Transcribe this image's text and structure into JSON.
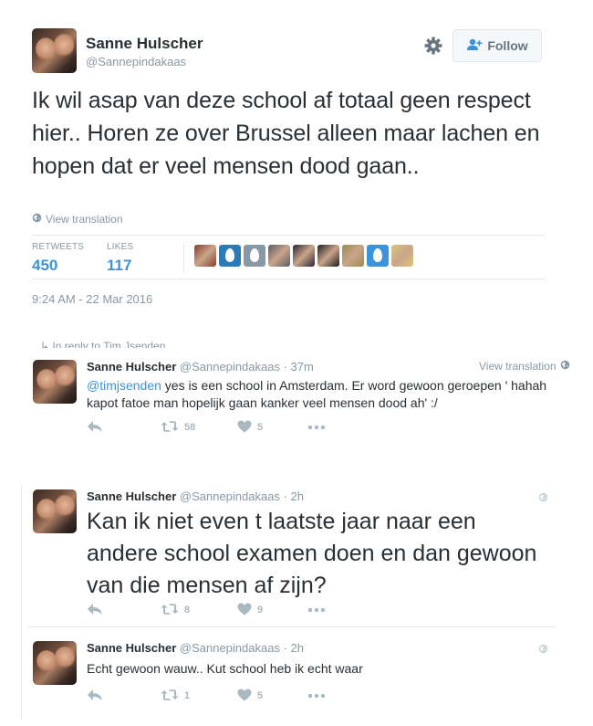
{
  "main_tweet": {
    "author_name": "Sanne Hulscher",
    "author_handle": "@Sannepindakaas",
    "follow_label": "Follow",
    "text": "Ik wil asap van deze school af totaal geen respect hier.. Horen ze over Brussel alleen maar lachen en hopen dat er veel mensen dood gaan..",
    "view_translation": "View translation",
    "retweets_label": "RETWEETS",
    "retweets_count": "450",
    "likes_label": "LIKES",
    "likes_count": "117",
    "timestamp": "9:24 AM - 22 Mar 2016",
    "liker_avatars": [
      {
        "icon": "photo-avatar",
        "color": "#8a3b2e"
      },
      {
        "icon": "egg-avatar",
        "color": "#2b7bb9"
      },
      {
        "icon": "egg-avatar",
        "color": "#8899a6"
      },
      {
        "icon": "photo-avatar",
        "color": "#5c5a66"
      },
      {
        "icon": "photo-avatar",
        "color": "#2a2230"
      },
      {
        "icon": "photo-avatar",
        "color": "#1d1d1d"
      },
      {
        "icon": "photo-avatar",
        "color": "#9a8a52"
      },
      {
        "icon": "egg-avatar",
        "color": "#3b94d9"
      },
      {
        "icon": "photo-avatar",
        "color": "#d8c77a"
      }
    ]
  },
  "cut_off_line": "↳ In reply to Tim Jsenden",
  "replies": [
    {
      "author_name": "Sanne Hulscher",
      "author_handle": "@Sannepindakaas · 37m",
      "view_translation": "View translation",
      "mention": "@timjsenden",
      "text": " yes is een school in Amsterdam. Er word gewoon geroepen ' hahah kapot fatoe man hopelijk gaan kanker veel mensen dood ah' :/",
      "retweets": "58",
      "likes": "5"
    },
    {
      "author_name": "Sanne Hulscher",
      "author_handle": "@Sannepindakaas · 2h",
      "text": "Kan ik niet even t laatste jaar naar een andere school examen doen en dan gewoon van die mensen af zijn?",
      "retweets": "8",
      "likes": "9"
    },
    {
      "author_name": "Sanne Hulscher",
      "author_handle": "@Sannepindakaas · 2h",
      "text": "Echt gewoon wauw.. Kut school heb ik echt waar",
      "retweets": "1",
      "likes": "5"
    }
  ],
  "colors": {
    "text": "#292f33",
    "muted": "#8899a6",
    "link": "#3b94d9",
    "action_icon": "#aab8c2",
    "border": "#e1e8ed"
  }
}
